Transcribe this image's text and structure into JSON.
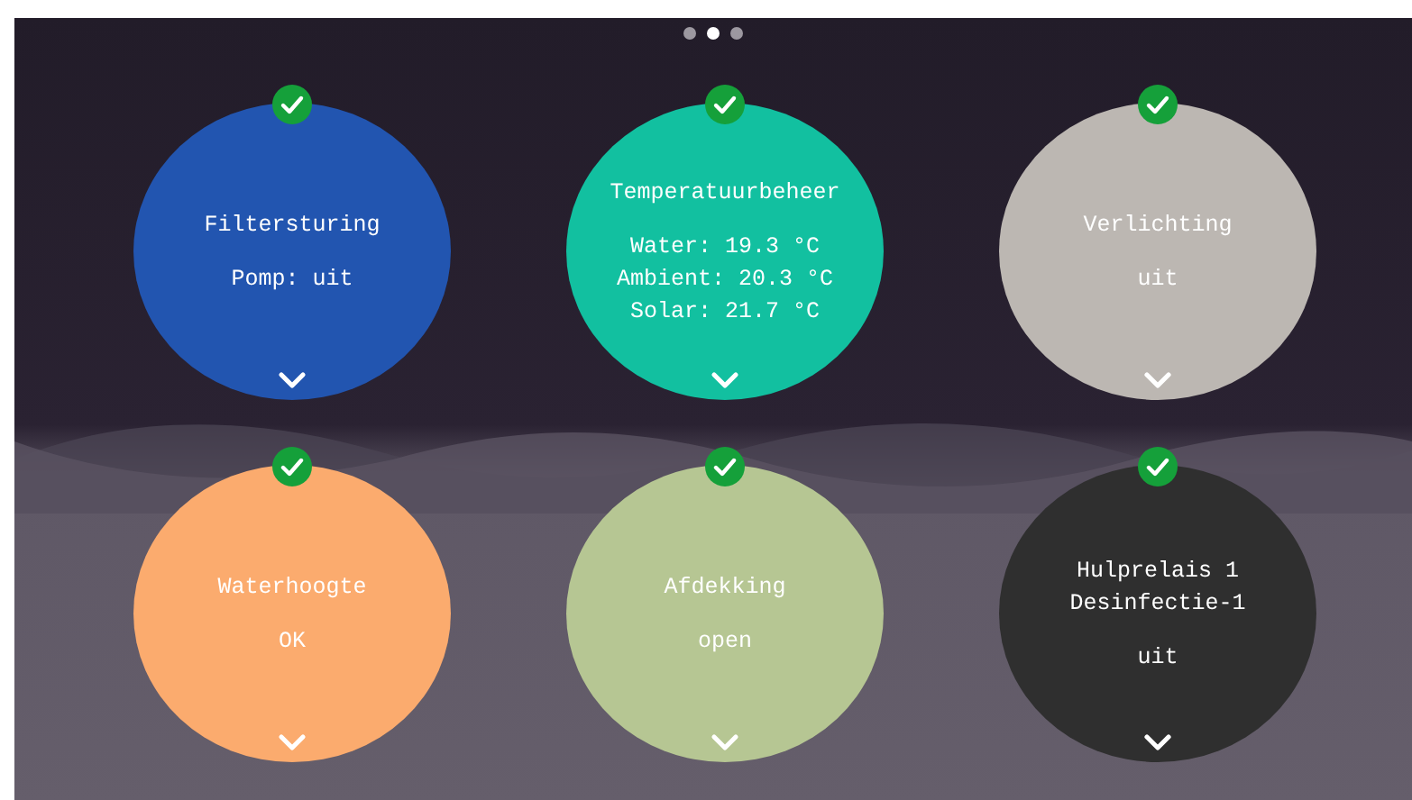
{
  "page_dots": [
    {
      "selected": false
    },
    {
      "selected": true
    },
    {
      "selected": false
    }
  ],
  "tiles": [
    {
      "title": [
        "Filtersturing"
      ],
      "status": [
        "Pomp: uit"
      ],
      "color": "#2255b0",
      "ok": true
    },
    {
      "title": [
        "Temperatuurbeheer"
      ],
      "status": [
        "Water: 19.3 °C",
        "Ambient: 20.3 °C",
        "Solar: 21.7 °C"
      ],
      "color": "#12c0a0",
      "ok": true
    },
    {
      "title": [
        "Verlichting"
      ],
      "status": [
        "uit"
      ],
      "color": "#bcb7b2",
      "ok": true
    },
    {
      "title": [
        "Waterhoogte"
      ],
      "status": [
        "OK"
      ],
      "color": "#fbab6e",
      "ok": true
    },
    {
      "title": [
        "Afdekking"
      ],
      "status": [
        "open"
      ],
      "color": "#b6c693",
      "ok": true
    },
    {
      "title": [
        "Hulprelais 1",
        "Desinfectie-1"
      ],
      "status": [
        "uit"
      ],
      "color": "#2f2f2f",
      "ok": true
    }
  ]
}
